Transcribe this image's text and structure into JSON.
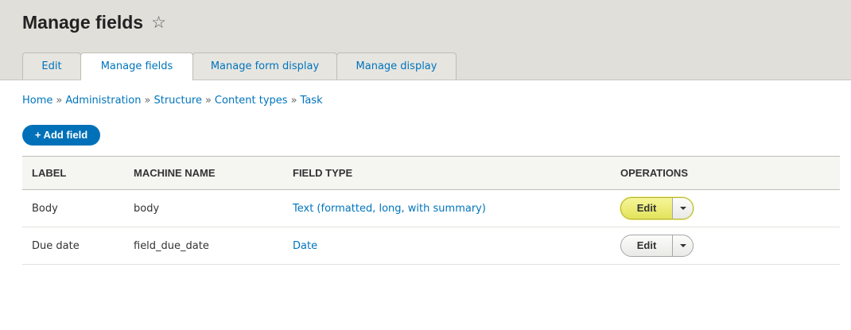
{
  "header": {
    "title": "Manage fields",
    "star_icon": "star-outline-icon"
  },
  "tabs": [
    {
      "label": "Edit",
      "active": false
    },
    {
      "label": "Manage fields",
      "active": true
    },
    {
      "label": "Manage form display",
      "active": false
    },
    {
      "label": "Manage display",
      "active": false
    }
  ],
  "breadcrumb": [
    {
      "label": "Home"
    },
    {
      "label": "Administration"
    },
    {
      "label": "Structure"
    },
    {
      "label": "Content types"
    },
    {
      "label": "Task"
    }
  ],
  "breadcrumb_separator": "»",
  "add_button": {
    "label": "+ Add field"
  },
  "table": {
    "headers": [
      "LABEL",
      "MACHINE NAME",
      "FIELD TYPE",
      "OPERATIONS"
    ],
    "rows": [
      {
        "label": "Body",
        "machine_name": "body",
        "field_type": "Text (formatted, long, with summary)",
        "operation": "Edit",
        "highlighted": true
      },
      {
        "label": "Due date",
        "machine_name": "field_due_date",
        "field_type": "Date",
        "operation": "Edit",
        "highlighted": false
      }
    ]
  },
  "colors": {
    "header_bg": "#e0dfda",
    "link": "#0074bd",
    "primary_button": "#0071b8",
    "highlight": "#eaea6e"
  }
}
